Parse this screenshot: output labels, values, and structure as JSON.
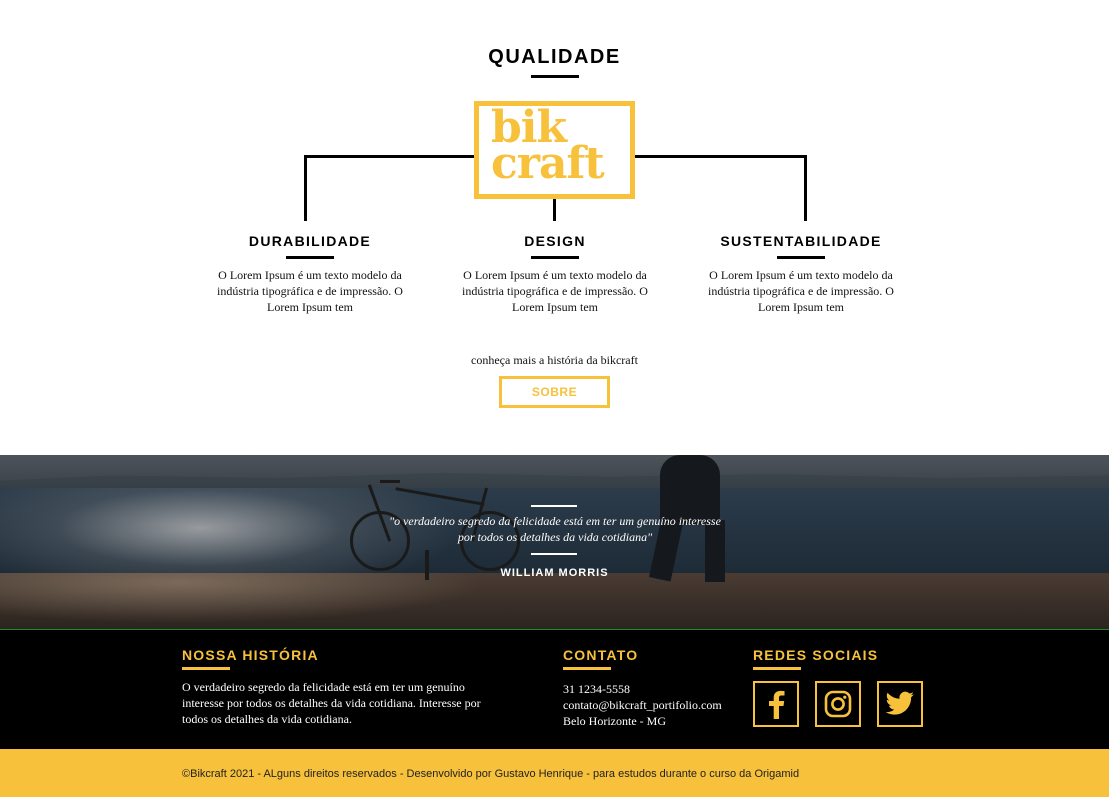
{
  "quality": {
    "title": "QUALIDADE",
    "logo": {
      "line1": "bik",
      "line2": "craft"
    },
    "features": [
      {
        "title": "DURABILIDADE",
        "text": "O Lorem Ipsum é um texto modelo da indústria tipográfica e de impressão. O Lorem Ipsum tem"
      },
      {
        "title": "DESIGN",
        "text": "O Lorem Ipsum é um texto modelo da indústria tipográfica e de impressão. O Lorem Ipsum tem"
      },
      {
        "title": "SUSTENTABILIDADE",
        "text": "O Lorem Ipsum é um texto modelo da indústria tipográfica e de impressão. O Lorem Ipsum tem"
      }
    ],
    "more_text": "conheça mais a história da bikcraft",
    "button_label": "SOBRE"
  },
  "quote": {
    "text": "\"o verdadeiro segredo da felicidade está em ter um genuíno interesse por todos os detalhes da vida cotidiana\"",
    "author": "WILLIAM MORRIS"
  },
  "footer": {
    "history": {
      "title": "NOSSA HISTÓRIA",
      "text": "O verdadeiro segredo da felicidade está em ter um genuíno interesse por todos os detalhes da vida cotidiana. Interesse por todos os detalhes da vida cotidiana."
    },
    "contact": {
      "title": "CONTATO",
      "phone": "31 1234-5558",
      "email": "contato@bikcraft_portifolio.com",
      "city": "Belo Horizonte - MG"
    },
    "social": {
      "title": "REDES SOCIAIS",
      "icons": [
        "facebook-icon",
        "instagram-icon",
        "twitter-icon"
      ]
    },
    "copyright": "©Bikcraft 2021 - ALguns direitos reservados - Desenvolvido por Gustavo Henrique - para estudos durante o curso da Origamid"
  },
  "colors": {
    "accent": "#f7c13c",
    "dark": "#000000",
    "white": "#ffffff"
  }
}
